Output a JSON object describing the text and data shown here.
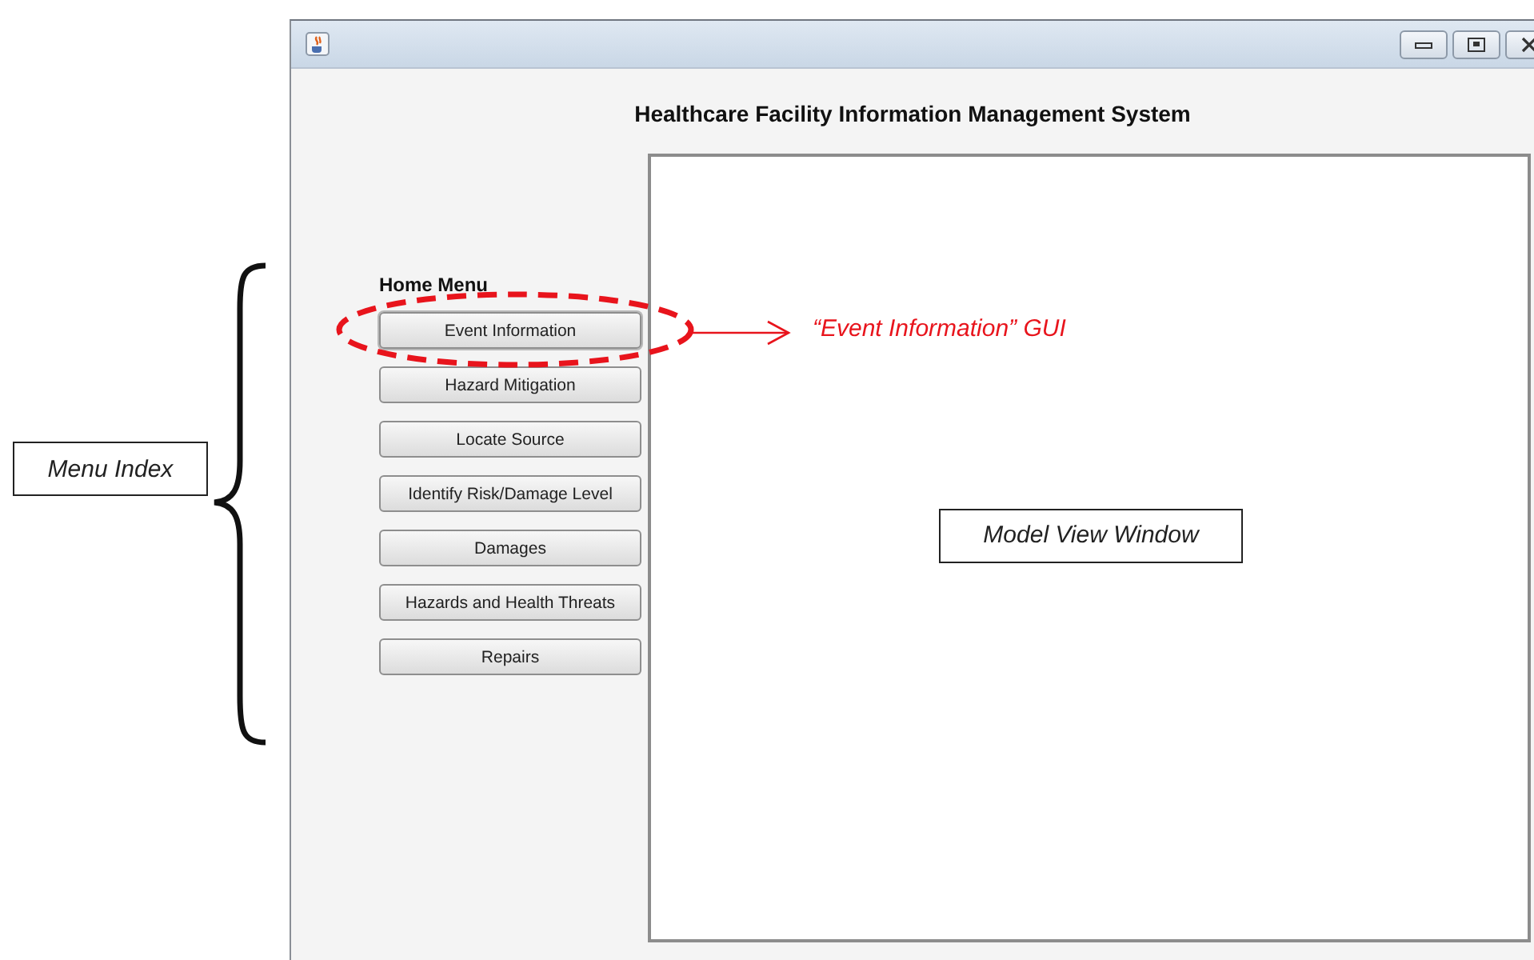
{
  "annotations": {
    "menu_label": "Menu Index",
    "callout": "“Event Information” GUI",
    "panel_label": "Model View  Window"
  },
  "window": {
    "app_title": "Healthcare Facility Information Management System"
  },
  "menu": {
    "heading": "Home Menu",
    "buttons": [
      {
        "label": "Event Information",
        "highlighted": true
      },
      {
        "label": "Hazard Mitigation",
        "highlighted": false
      },
      {
        "label": "Locate Source",
        "highlighted": false
      },
      {
        "label": "Identify Risk/Damage Level",
        "highlighted": false
      },
      {
        "label": "Damages",
        "highlighted": false
      },
      {
        "label": "Hazards and Health Threats",
        "highlighted": false
      },
      {
        "label": "Repairs",
        "highlighted": false
      }
    ]
  }
}
